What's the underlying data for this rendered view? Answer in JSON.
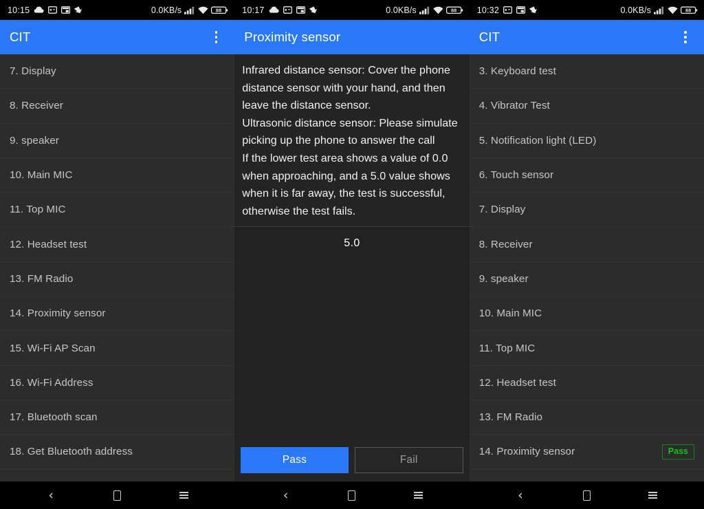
{
  "theme": {
    "accent_blue": "#2a78f5",
    "list_bg": "#2c2c2c",
    "detail_bg": "#242424",
    "pass_green": "#12c213",
    "text_primary": "#f2f2f2",
    "text_secondary": "#c6c6c6"
  },
  "panels": [
    {
      "id": "left",
      "status_bar": {
        "time": "10:15",
        "net_rate": "0.0KB/s",
        "battery_level": "88",
        "icons_left": [
          "cloud-icon",
          "screenshot-icon",
          "picture-in-picture-icon",
          "download-icon"
        ],
        "icons_right": [
          "signal-bars-icon",
          "wifi-icon",
          "battery-icon"
        ]
      },
      "app_bar": {
        "title": "CIT",
        "overflow_menu": "overflow-menu-icon"
      },
      "list": [
        {
          "label": "7. Display",
          "badge": null
        },
        {
          "label": "8. Receiver",
          "badge": null
        },
        {
          "label": "9. speaker",
          "badge": null
        },
        {
          "label": "10. Main MIC",
          "badge": null
        },
        {
          "label": "11. Top MIC",
          "badge": null
        },
        {
          "label": "12. Headset test",
          "badge": null
        },
        {
          "label": "13. FM Radio",
          "badge": null
        },
        {
          "label": "14. Proximity sensor",
          "badge": null
        },
        {
          "label": "15. Wi-Fi AP Scan",
          "badge": null
        },
        {
          "label": "16. Wi-Fi Address",
          "badge": null
        },
        {
          "label": "17. Bluetooth scan",
          "badge": null
        },
        {
          "label": "18. Get Bluetooth address",
          "badge": null
        }
      ]
    },
    {
      "id": "middle",
      "status_bar": {
        "time": "10:17",
        "net_rate": "0.0KB/s",
        "battery_level": "88",
        "icons_left": [
          "cloud-icon",
          "screenshot-icon",
          "picture-in-picture-icon",
          "download-icon"
        ],
        "icons_right": [
          "signal-bars-icon",
          "wifi-icon",
          "battery-icon"
        ]
      },
      "app_bar": {
        "title": "Proximity sensor",
        "overflow_menu": null
      },
      "detail": {
        "description": "Infrared distance sensor: Cover the phone distance sensor with your hand, and then leave the distance sensor.\n Ultrasonic distance sensor: Please simulate picking up the phone to answer the call\n If the lower test area shows a value of 0.0 when approaching, and a 5.0 value shows when it is far away, the test is successful, otherwise the test fails.",
        "sensor_value": "5.0",
        "pass_label": "Pass",
        "fail_label": "Fail"
      }
    },
    {
      "id": "right",
      "status_bar": {
        "time": "10:32",
        "net_rate": "0.0KB/s",
        "battery_level": "88",
        "icons_left": [
          "screenshot-icon",
          "picture-in-picture-icon",
          "download-icon"
        ],
        "icons_right": [
          "signal-bars-icon",
          "wifi-icon",
          "battery-icon"
        ]
      },
      "app_bar": {
        "title": "CIT",
        "overflow_menu": "overflow-menu-icon"
      },
      "list": [
        {
          "label": "3. Keyboard test",
          "badge": null
        },
        {
          "label": "4. Vibrator Test",
          "badge": null
        },
        {
          "label": "5. Notification light (LED)",
          "badge": null
        },
        {
          "label": "6. Touch sensor",
          "badge": null
        },
        {
          "label": "7. Display",
          "badge": null
        },
        {
          "label": "8. Receiver",
          "badge": null
        },
        {
          "label": "9. speaker",
          "badge": null
        },
        {
          "label": "10. Main MIC",
          "badge": null
        },
        {
          "label": "11. Top MIC",
          "badge": null
        },
        {
          "label": "12. Headset test",
          "badge": null
        },
        {
          "label": "13. FM Radio",
          "badge": null
        },
        {
          "label": "14. Proximity sensor",
          "badge": "Pass"
        }
      ]
    }
  ],
  "nav_bar": {
    "back": "back-chevron-icon",
    "home": "home-square-icon",
    "recents": "recents-menu-icon"
  }
}
